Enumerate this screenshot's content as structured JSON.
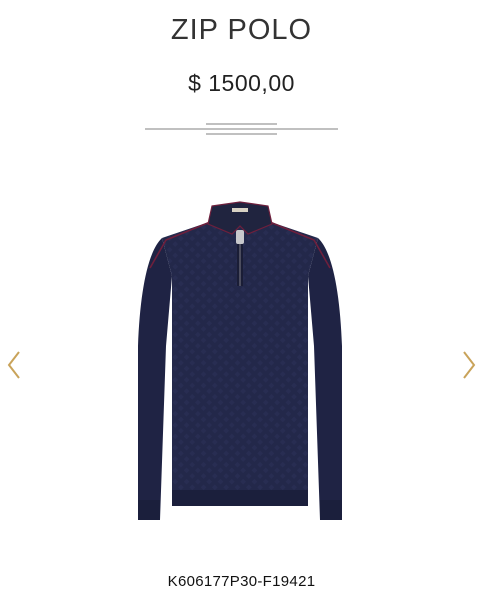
{
  "product": {
    "title": "ZIP POLO",
    "price": "$ 1500,00",
    "sku": "K606177P30-F19421",
    "image": "navy-zip-polo-sweater",
    "colors": {
      "knit": "#23284a",
      "trim": "#6e1f3c",
      "accent": "#c8a45a"
    }
  },
  "navigation": {
    "prev_icon": "chevron-left-icon",
    "next_icon": "chevron-right-icon"
  }
}
